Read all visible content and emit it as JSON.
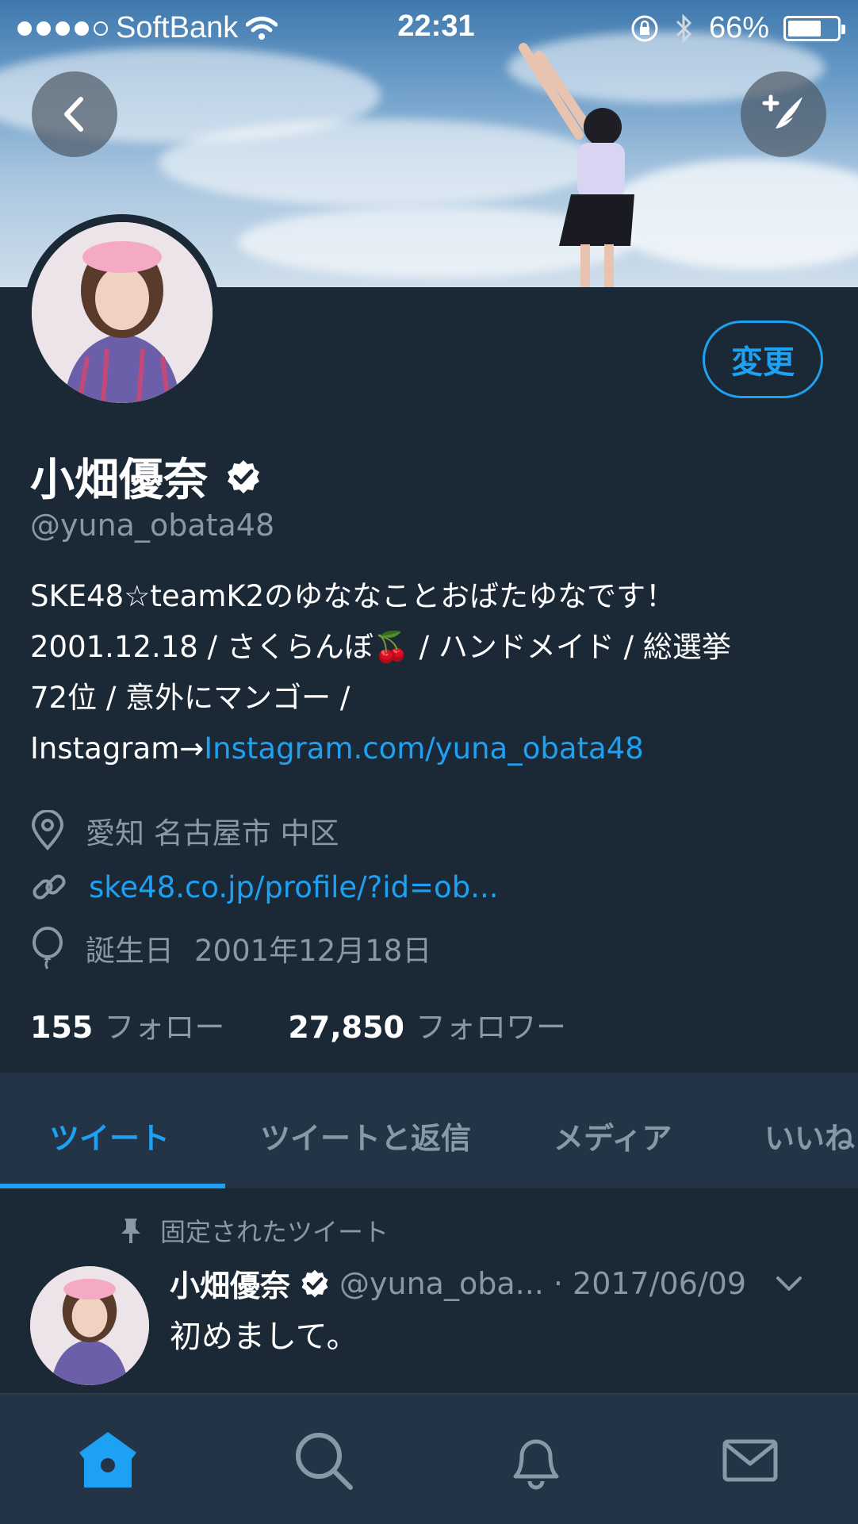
{
  "status_bar": {
    "carrier": "SoftBank",
    "time": "22:31",
    "battery": "66%",
    "battery_level": 0.66
  },
  "header": {
    "back_icon": "chevron-left-icon",
    "compose_icon": "compose-tweet-icon"
  },
  "profile": {
    "edit_button": "変更",
    "display_name": "小畑優奈",
    "verified_icon": "verified-badge-icon",
    "handle": "@yuna_obata48",
    "bio_line1": "SKE48☆teamK2のゆななことおばたゆなです！",
    "bio_line2": "2001.12.18 / さくらんぼ🍒 / ハンドメイド / 総選挙",
    "bio_line3": "72位 / 意外にマンゴー /",
    "bio_line4_prefix": "Instagram→",
    "bio_line4_link": "Instagram.com/yuna_obata48",
    "location": "愛知 名古屋市 中区",
    "website": "ske48.co.jp/profile/?id=ob...",
    "birthday_label": "誕生日",
    "birthday": "2001年12月18日",
    "following_count": "155",
    "following_label": "フォロー",
    "followers_count": "27,850",
    "followers_label": "フォロワー"
  },
  "tabs": [
    {
      "label": "ツイート",
      "active": true
    },
    {
      "label": "ツイートと返信",
      "active": false
    },
    {
      "label": "メディア",
      "active": false
    },
    {
      "label": "いいね",
      "active": false
    }
  ],
  "pinned_tweet": {
    "pinned_label": "固定されたツイート",
    "author_name": "小畑優奈",
    "author_handle": "@yuna_oba...",
    "date": "· 2017/06/09",
    "text": "初めまして。"
  },
  "bottom_nav": [
    "home-icon",
    "search-icon",
    "notifications-icon",
    "messages-icon"
  ],
  "colors": {
    "background": "#1b2836",
    "panel": "#243447",
    "accent": "#1da1f2",
    "secondary_text": "#8899a6"
  }
}
